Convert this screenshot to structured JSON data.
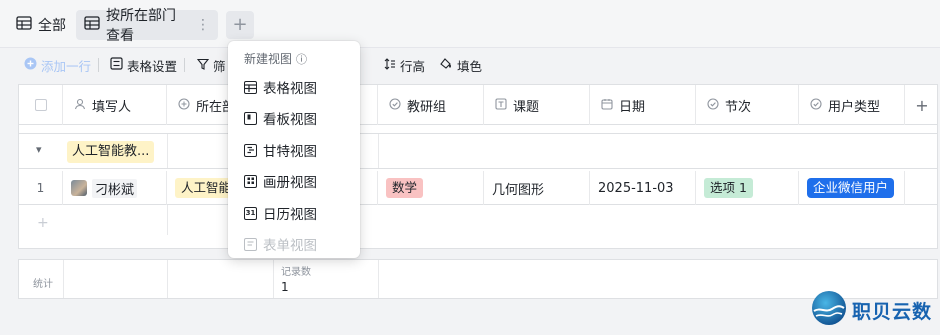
{
  "tabs": {
    "all": "全部",
    "active": "按所在部门查看",
    "more": "⋮",
    "add": "+"
  },
  "toolbar": {
    "add_row": "添加一行",
    "table_settings": "表格设置",
    "filter": "筛",
    "row_height": "行高",
    "fill_color": "填色"
  },
  "columns": [
    {
      "label": "填写人",
      "icon": "person-icon"
    },
    {
      "label": "所在部",
      "icon": "department-icon"
    },
    {
      "label": "",
      "icon": ""
    },
    {
      "label": "教研组",
      "icon": "option-icon"
    },
    {
      "label": "课题",
      "icon": "text-icon"
    },
    {
      "label": "日期",
      "icon": "calendar-icon"
    },
    {
      "label": "节次",
      "icon": "option-icon"
    },
    {
      "label": "用户类型",
      "icon": "option-icon"
    }
  ],
  "add_column": "+",
  "group": {
    "toggle": "▾",
    "label": "人工智能教..."
  },
  "row": {
    "index": "1",
    "user": "刁彬斌",
    "department": "人工智能",
    "teaching_group": "数学",
    "topic": "几何图形",
    "date": "2025-11-03",
    "period": "选项 1",
    "user_type": "企业微信用户"
  },
  "add_row_plus": "+",
  "summary": {
    "label": "统计",
    "record_label": "记录数",
    "record_count": "1"
  },
  "popup": {
    "title": "新建视图",
    "info": "ⓘ",
    "items": [
      "表格视图",
      "看板视图",
      "甘特视图",
      "画册视图",
      "日历视图",
      "表单视图"
    ]
  },
  "brand": {
    "name": "职贝云数",
    "color": "#1763b0"
  },
  "colors": {
    "accent": "#1f6feb",
    "tag_yellow": "#fef3c7",
    "tag_red": "#f9c2c2",
    "tag_green": "#c5ebd6"
  }
}
